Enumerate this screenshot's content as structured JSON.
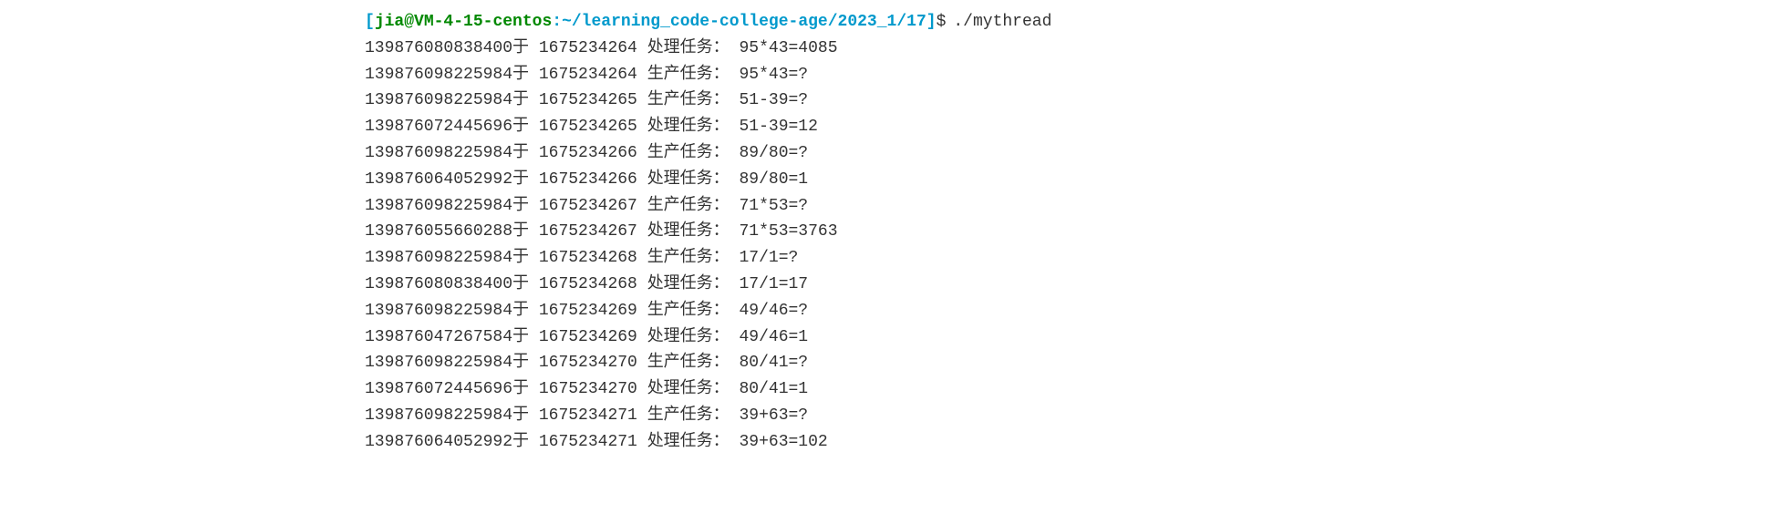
{
  "prompt": {
    "bracket_open": "[",
    "user": "jia",
    "at": "@",
    "host": "VM-4-15-centos",
    "colon": ":",
    "path": "~/learning_code-college-age/2023_1/17",
    "bracket_close": "]",
    "dollar": "$",
    "command": "./mythread"
  },
  "lines": [
    {
      "thread_id": "139876080838400",
      "at": "于",
      "timestamp": "1675234264",
      "action": "处理任务：",
      "task": "95*43=4085"
    },
    {
      "thread_id": "139876098225984",
      "at": "于",
      "timestamp": "1675234264",
      "action": "生产任务：",
      "task": "95*43=?"
    },
    {
      "thread_id": "139876098225984",
      "at": "于",
      "timestamp": "1675234265",
      "action": "生产任务：",
      "task": "51-39=?"
    },
    {
      "thread_id": "139876072445696",
      "at": "于",
      "timestamp": "1675234265",
      "action": "处理任务：",
      "task": "51-39=12"
    },
    {
      "thread_id": "139876098225984",
      "at": "于",
      "timestamp": "1675234266",
      "action": "生产任务：",
      "task": "89/80=?"
    },
    {
      "thread_id": "139876064052992",
      "at": "于",
      "timestamp": "1675234266",
      "action": "处理任务：",
      "task": "89/80=1"
    },
    {
      "thread_id": "139876098225984",
      "at": "于",
      "timestamp": "1675234267",
      "action": "生产任务：",
      "task": "71*53=?"
    },
    {
      "thread_id": "139876055660288",
      "at": "于",
      "timestamp": "1675234267",
      "action": "处理任务：",
      "task": "71*53=3763"
    },
    {
      "thread_id": "139876098225984",
      "at": "于",
      "timestamp": "1675234268",
      "action": "生产任务：",
      "task": "17/1=?"
    },
    {
      "thread_id": "139876080838400",
      "at": "于",
      "timestamp": "1675234268",
      "action": "处理任务：",
      "task": "17/1=17"
    },
    {
      "thread_id": "139876098225984",
      "at": "于",
      "timestamp": "1675234269",
      "action": "生产任务：",
      "task": "49/46=?"
    },
    {
      "thread_id": "139876047267584",
      "at": "于",
      "timestamp": "1675234269",
      "action": "处理任务：",
      "task": "49/46=1"
    },
    {
      "thread_id": "139876098225984",
      "at": "于",
      "timestamp": "1675234270",
      "action": "生产任务：",
      "task": "80/41=?"
    },
    {
      "thread_id": "139876072445696",
      "at": "于",
      "timestamp": "1675234270",
      "action": "处理任务：",
      "task": "80/41=1"
    },
    {
      "thread_id": "139876098225984",
      "at": "于",
      "timestamp": "1675234271",
      "action": "生产任务：",
      "task": "39+63=?"
    },
    {
      "thread_id": "139876064052992",
      "at": "于",
      "timestamp": "1675234271",
      "action": "处理任务：",
      "task": "39+63=102"
    }
  ]
}
